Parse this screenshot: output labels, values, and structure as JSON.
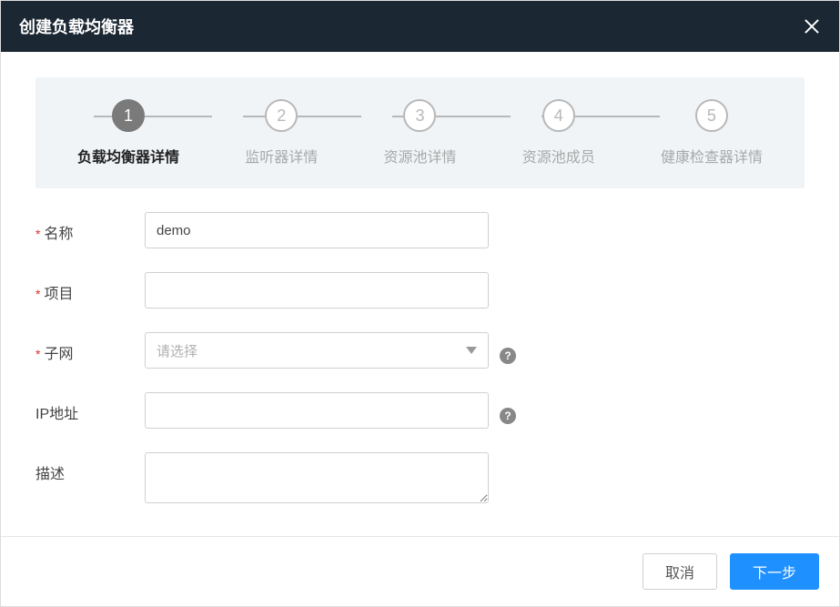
{
  "modal": {
    "title": "创建负载均衡器"
  },
  "steps": [
    {
      "num": "1",
      "label": "负载均衡器详情",
      "active": true
    },
    {
      "num": "2",
      "label": "监听器详情",
      "active": false
    },
    {
      "num": "3",
      "label": "资源池详情",
      "active": false
    },
    {
      "num": "4",
      "label": "资源池成员",
      "active": false
    },
    {
      "num": "5",
      "label": "健康检查器详情",
      "active": false
    }
  ],
  "form": {
    "name": {
      "label": "名称",
      "value": "demo",
      "required": true
    },
    "project": {
      "label": "项目",
      "value": "",
      "required": true
    },
    "subnet": {
      "label": "子网",
      "placeholder": "请选择",
      "required": true
    },
    "ip": {
      "label": "IP地址",
      "value": ""
    },
    "desc": {
      "label": "描述",
      "value": ""
    }
  },
  "footer": {
    "cancel": "取消",
    "next": "下一步"
  }
}
